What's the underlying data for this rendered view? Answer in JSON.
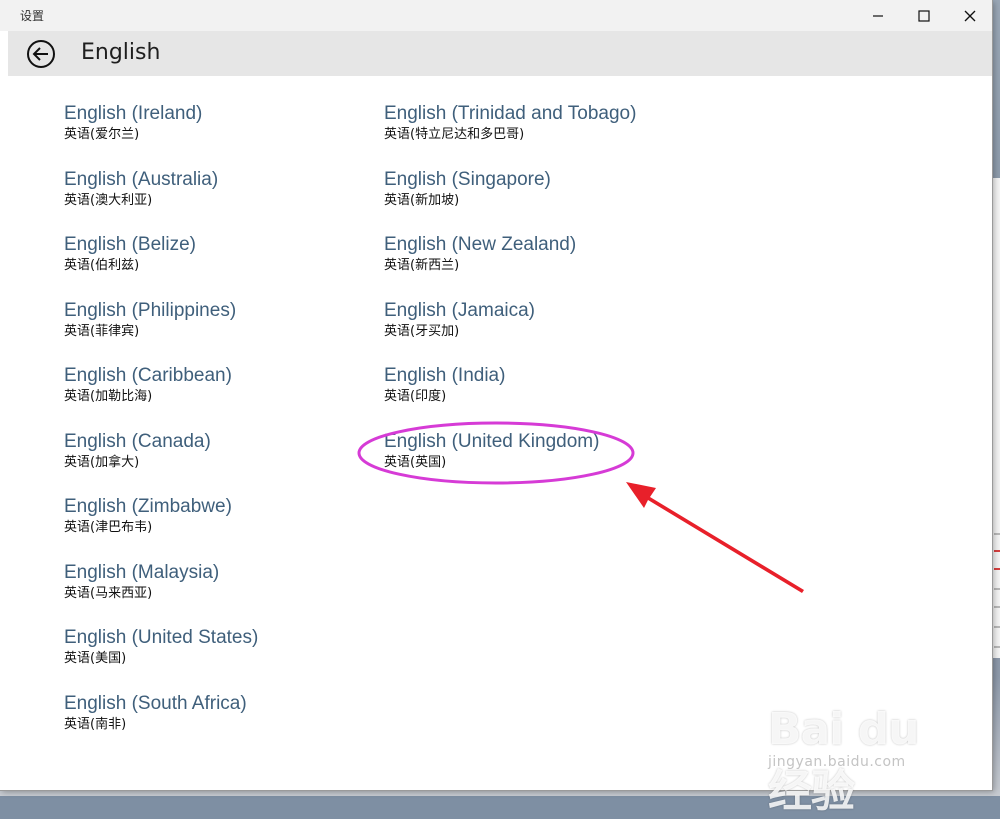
{
  "window": {
    "title": "设置"
  },
  "header": {
    "back_icon": "back-arrow-circle-icon",
    "title": "English"
  },
  "languages_left": [
    {
      "name": "English (Ireland)",
      "native": "英语(爱尔兰)"
    },
    {
      "name": "English (Australia)",
      "native": "英语(澳大利亚)"
    },
    {
      "name": "English (Belize)",
      "native": "英语(伯利兹)"
    },
    {
      "name": "English (Philippines)",
      "native": "英语(菲律宾)"
    },
    {
      "name": "English (Caribbean)",
      "native": "英语(加勒比海)"
    },
    {
      "name": "English (Canada)",
      "native": "英语(加拿大)"
    },
    {
      "name": "English (Zimbabwe)",
      "native": "英语(津巴布韦)"
    },
    {
      "name": "English (Malaysia)",
      "native": "英语(马来西亚)"
    },
    {
      "name": "English (United States)",
      "native": "英语(美国)"
    },
    {
      "name": "English (South Africa)",
      "native": "英语(南非)"
    }
  ],
  "languages_right": [
    {
      "name": "English (Trinidad and Tobago)",
      "native": "英语(特立尼达和多巴哥)"
    },
    {
      "name": "English (Singapore)",
      "native": "英语(新加坡)"
    },
    {
      "name": "English (New Zealand)",
      "native": "英语(新西兰)"
    },
    {
      "name": "English (Jamaica)",
      "native": "英语(牙买加)"
    },
    {
      "name": "English (India)",
      "native": "英语(印度)"
    },
    {
      "name": "English (United Kingdom)",
      "native": "英语(英国)"
    }
  ],
  "annotation": {
    "highlight_color": "#d63bd6",
    "arrow_color": "#e8202a"
  },
  "colors": {
    "language_name": "#3f5f7b",
    "header_bg": "#e6e6e6",
    "titlebar_bg": "#f2f2f2"
  },
  "watermark": {
    "main": "Bai du 经验",
    "sub": "jingyan.baidu.com"
  }
}
